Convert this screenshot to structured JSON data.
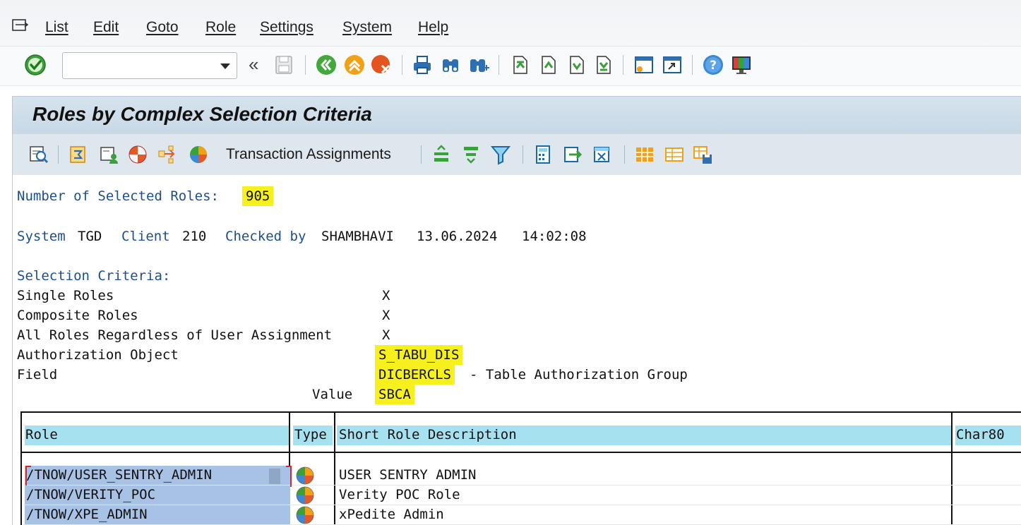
{
  "menu": {
    "items": [
      "List",
      "Edit",
      "Goto",
      "Role",
      "Settings",
      "System",
      "Help"
    ]
  },
  "toolbar": {
    "command_value": "",
    "back_glyph": "«"
  },
  "title": "Roles by Complex Selection Criteria",
  "app_toolbar": {
    "transaction_assignments": "Transaction Assignments"
  },
  "summary": {
    "count_label": "Number of Selected Roles:",
    "count_value": "905"
  },
  "header_info": {
    "system_label": "System",
    "system_value": "TGD",
    "client_label": "Client",
    "client_value": "210",
    "checked_label": "Checked by",
    "checked_value": "SHAMBHAVI",
    "date": "13.06.2024",
    "time": "14:02:08"
  },
  "criteria": {
    "heading": "Selection Criteria:",
    "single_roles": {
      "label": "Single Roles",
      "value": "X"
    },
    "composite_roles": {
      "label": "Composite Roles",
      "value": "X"
    },
    "all_roles": {
      "label": "All Roles Regardless of User Assignment",
      "value": "X"
    },
    "auth_object": {
      "label": "Authorization Object",
      "value": "S_TABU_DIS"
    },
    "field": {
      "label": "Field",
      "value": "DICBERCLS",
      "description": "- Table Authorization Group"
    },
    "value": {
      "label": "Value",
      "value": "SBCA"
    }
  },
  "table": {
    "columns": [
      "Role",
      "Type",
      "Short Role Description",
      "Char80"
    ],
    "rows": [
      {
        "role": "/TNOW/USER_SENTRY_ADMIN",
        "description": "USER SENTRY ADMIN"
      },
      {
        "role": "/TNOW/VERITY_POC",
        "description": "Verity POC Role"
      },
      {
        "role": "/TNOW/XPE_ADMIN",
        "description": "xPedite Admin"
      }
    ]
  },
  "colors": {
    "highlight": "#f6f01c",
    "blue_text": "#1c4f8c",
    "header_fill": "#a6e1f0",
    "selected_cell": "#a8c2e6"
  }
}
